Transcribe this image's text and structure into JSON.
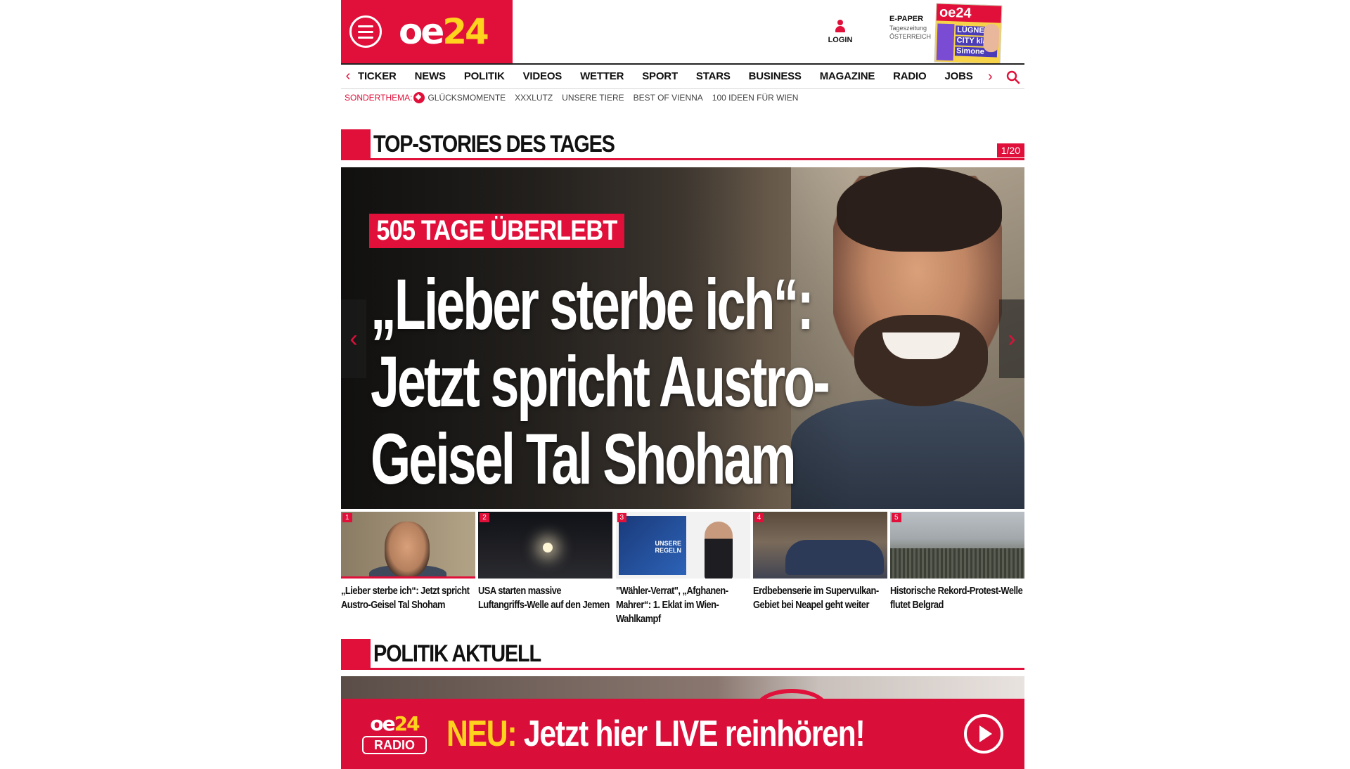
{
  "header": {
    "logo_oe": "oe",
    "logo_24": "24",
    "login_label": "LOGIN",
    "epaper_title": "E-PAPER",
    "epaper_sub1": "Tageszeitung",
    "epaper_sub2": "ÖSTERREICH",
    "epaper_cover": {
      "masthead": "oe24",
      "lines": [
        "LÜGNER",
        "CITY klärt",
        "Simone"
      ]
    }
  },
  "nav": {
    "prev_arrow": "‹",
    "next_arrow": "›",
    "items": [
      "TICKER",
      "NEWS",
      "POLITIK",
      "VIDEOS",
      "WETTER",
      "SPORT",
      "STARS",
      "BUSINESS",
      "MAGAZINE",
      "RADIO",
      "JOBS"
    ]
  },
  "subnav": {
    "label": "SONDERTHEMA:",
    "items": [
      "GLÜCKSMOMENTE",
      "XXXLUTZ",
      "UNSERE TIERE",
      "BEST OF VIENNA",
      "100 IDEEN FÜR WIEN"
    ]
  },
  "top_stories": {
    "title": "TOP-STORIES DES TAGES",
    "counter": "1/20",
    "hero": {
      "kicker": "505 TAGE ÜBERLEBT",
      "title": "„Lieber sterbe ich“: Jetzt spricht Austro-Geisel Tal Shoham",
      "prev": "‹",
      "next": "›"
    },
    "thumbs": [
      {
        "num": "1",
        "title": "„Lieber sterbe ich“: Jetzt spricht Austro-Geisel Tal Shoham"
      },
      {
        "num": "2",
        "title": "USA starten massive Luftangriffs-Welle auf den Jemen"
      },
      {
        "num": "3",
        "title": "\"Wähler-Verrat\", „Afghanen-Mahrer“: 1. Eklat im Wien-Wahlkampf",
        "screen_text": "UNSERE REGELN"
      },
      {
        "num": "4",
        "title": "Erdbebenserie im Supervulkan-Gebiet bei Neapel geht weiter"
      },
      {
        "num": "5",
        "title": "Historische Rekord-Protest-Welle flutet Belgrad"
      }
    ]
  },
  "politik": {
    "title": "POLITIK AKTUELL"
  },
  "radio_banner": {
    "logo_oe": "oe",
    "logo_24": "24",
    "logo_radio": "RADIO",
    "neu": "NEU:",
    "text": " Jetzt hier LIVE reinhören!"
  },
  "colors": {
    "brand_red": "#e0103a",
    "brand_yellow": "#ffd21e"
  },
  "icons": [
    "menu-icon",
    "user-icon",
    "search-icon",
    "chevron-left-icon",
    "chevron-right-icon",
    "play-icon"
  ]
}
